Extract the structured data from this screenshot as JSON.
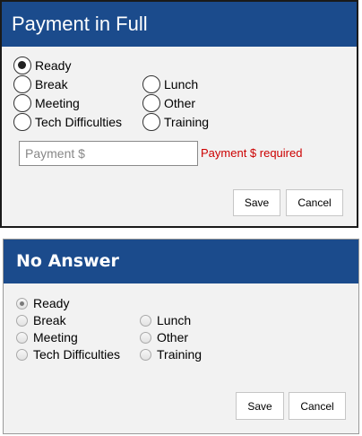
{
  "payment_dialog": {
    "title": "Payment in Full",
    "options": {
      "ready": "Ready",
      "break": "Break",
      "meeting": "Meeting",
      "tech": "Tech Difficulties",
      "lunch": "Lunch",
      "other": "Other",
      "training": "Training"
    },
    "selected": "Ready",
    "payment_input": {
      "value": "",
      "placeholder": "Payment $"
    },
    "error_text": "Payment $ required",
    "save_label": "Save",
    "cancel_label": "Cancel"
  },
  "no_answer_dialog": {
    "title": "No Answer",
    "options": {
      "ready": "Ready",
      "break": "Break",
      "meeting": "Meeting",
      "tech": "Tech Difficulties",
      "lunch": "Lunch",
      "other": "Other",
      "training": "Training"
    },
    "selected": "Ready",
    "save_label": "Save",
    "cancel_label": "Cancel"
  },
  "colors": {
    "titlebar": "#1b4b8c",
    "error": "#cc0000",
    "dialog_bg": "#f2f2f2"
  }
}
